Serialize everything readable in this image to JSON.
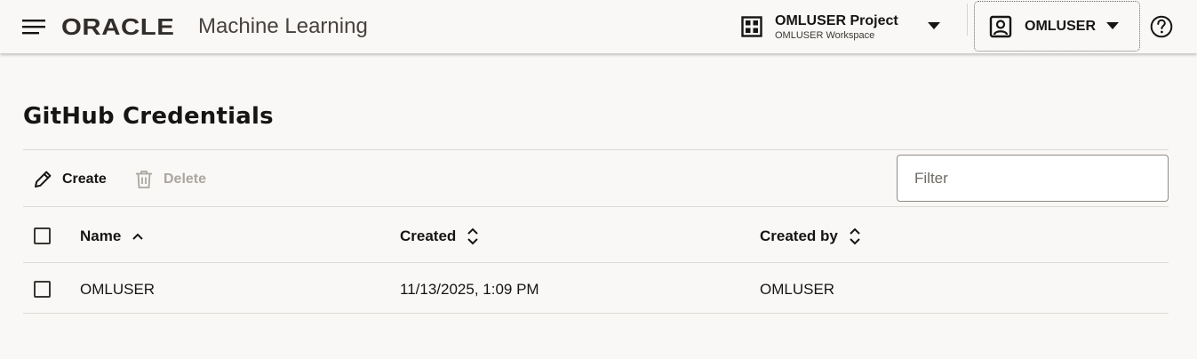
{
  "header": {
    "menu_icon": "hamburger-menu-icon",
    "brand_logo": "ORACLE",
    "app_name": "Machine Learning",
    "project": {
      "icon": "grid-icon",
      "name": "OMLUSER Project",
      "workspace": "OMLUSER Workspace"
    },
    "user": {
      "icon": "user-icon",
      "name": "OMLUSER"
    },
    "help_icon": "help-icon"
  },
  "page": {
    "title": "GitHub Credentials"
  },
  "toolbar": {
    "create_label": "Create",
    "delete_label": "Delete",
    "filter_placeholder": "Filter",
    "filter_value": ""
  },
  "table": {
    "columns": [
      {
        "label": "Name",
        "sort": "ascending"
      },
      {
        "label": "Created",
        "sort": "none"
      },
      {
        "label": "Created by",
        "sort": "none"
      }
    ],
    "rows": [
      {
        "name": "OMLUSER",
        "created": "11/13/2025, 1:09 PM",
        "created_by": "OMLUSER",
        "selected": false
      }
    ]
  },
  "colors": {
    "background": "#f9f8f6",
    "text": "#161513",
    "disabled_text": "#aaa6a0",
    "divider": "#dedad5"
  }
}
